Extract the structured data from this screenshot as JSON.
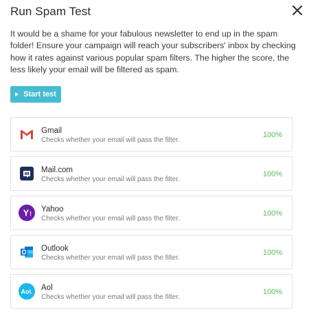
{
  "dialog": {
    "title": "Run Spam Test",
    "description": "It would be a shame for your fabulous newsletter to end up in the spam folder! Ensure your campaign will reach your subscribers' inbox by checking how it rates against various popular spam filters. The higher the score, the less likely your email will be filtered as spam.",
    "close_icon": "close-icon"
  },
  "start_button": {
    "label": "Start test",
    "icon": "play-icon",
    "color": "#46bcd3"
  },
  "providers": [
    {
      "name": "Gmail",
      "description": "Checks whether your email will pass the filter.",
      "score": "100%",
      "icon": "gmail-logo-icon"
    },
    {
      "name": "Mail.com",
      "description": "Checks whether your email will pass the filter.",
      "score": "100%",
      "icon": "mailcom-logo-icon"
    },
    {
      "name": "Yahoo",
      "description": "Checks whether your email will pass the filter.",
      "score": "100%",
      "icon": "yahoo-logo-icon"
    },
    {
      "name": "Outlook",
      "description": "Checks whether your email will pass the filter.",
      "score": "100%",
      "icon": "outlook-logo-icon"
    },
    {
      "name": "Aol",
      "description": "Checks whether your email will pass the filter.",
      "score": "100%",
      "icon": "aol-logo-icon"
    }
  ],
  "colors": {
    "score_green": "#5cb85c",
    "yahoo_purple": "#6b1fa8",
    "aol_blue": "#1ab7ea",
    "outlook_blue": "#0f6cbd",
    "mailcom_navy": "#1d2e5b",
    "gmail_red": "#d44638"
  }
}
